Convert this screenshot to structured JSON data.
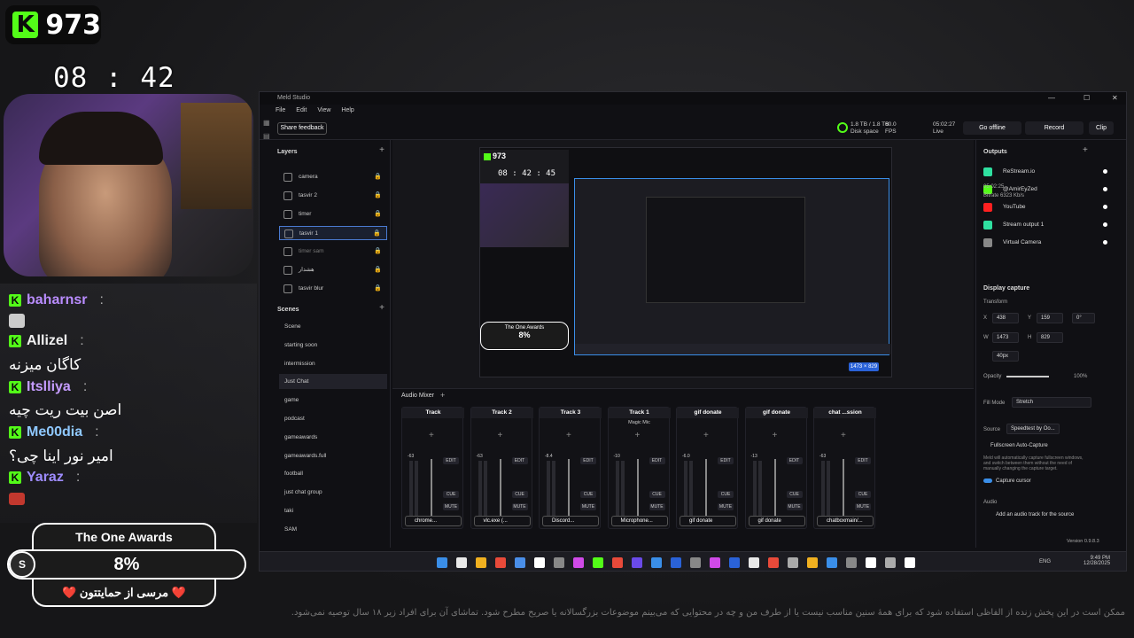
{
  "overlay": {
    "followers": "973",
    "timer": "08 : 42 : 45",
    "chat": [
      {
        "user": "baharnsr",
        "color": "#b98cff",
        "msg": ""
      },
      {
        "user": "Allizel",
        "color": "#f0f0f0",
        "msg": "کاگان میزنه"
      },
      {
        "user": "Itslliya",
        "color": "#c59cff",
        "msg": "اصن بیت ریت چیه"
      },
      {
        "user": "Me00dia",
        "color": "#8fc8ff",
        "msg": "امیر نور اینا چی؟"
      },
      {
        "user": "Yaraz",
        "color": "#9e8cff",
        "msg": ""
      }
    ],
    "awards_title": "The One Awards",
    "awards_percent": "8%",
    "awards_coin": "S",
    "awards_sub": "❤️ مرسی از حمایتتون ❤️"
  },
  "app": {
    "title": "Meld Studio",
    "menu": [
      "File",
      "Edit",
      "View",
      "Help"
    ],
    "share_feedback": "Share feedback",
    "disk": "1.8 TB / 1.8 TB",
    "disk_label": "Disk space",
    "fps": "60.0",
    "fps_label": "FPS",
    "live_time": "05:02:27",
    "live_label": "Live",
    "go_offline": "Go offline",
    "record": "Record",
    "clip": "Clip",
    "layers_title": "Layers",
    "layers": [
      {
        "name": "camera",
        "state": "normal"
      },
      {
        "name": "tasvir 2",
        "state": "normal"
      },
      {
        "name": "timer",
        "state": "normal"
      },
      {
        "name": "tasvir 1",
        "state": "selected"
      },
      {
        "name": "timer sam",
        "state": "dim"
      },
      {
        "name": "هشدار",
        "state": "normal"
      },
      {
        "name": "tasvir blur",
        "state": "normal"
      }
    ],
    "scenes_title": "Scenes",
    "scenes": [
      "Scene",
      "starting soon",
      "intermission",
      "Just Chat",
      "game",
      "podcast",
      "gameawards",
      "gameawards.full",
      "football",
      "just chat group",
      "taki",
      "SAM"
    ],
    "selected_scene": "Just Chat",
    "size_badge": "1473 × 829",
    "mixer_title": "Audio Mixer",
    "tracks": [
      {
        "name": "Track",
        "source": "chrome...",
        "db": "-63"
      },
      {
        "name": "Track 2",
        "source": "vlc.exe (...",
        "db": "-63"
      },
      {
        "name": "Track 3",
        "source": "Discord...",
        "db": "-8.4"
      },
      {
        "name": "Track 1",
        "source": "Microphone...",
        "db": "-10",
        "sub": "Magic Mic"
      },
      {
        "name": "gif donate",
        "source": "gif donate",
        "db": "-6.0"
      },
      {
        "name": "gif donate",
        "source": "gif donate",
        "db": "-13"
      },
      {
        "name": "chat ...ssion",
        "source": "chatboxmain/...",
        "db": "-63"
      }
    ],
    "track_buttons": [
      "EDIT",
      "CUE",
      "MUTE"
    ],
    "outputs_title": "Outputs",
    "outputs": [
      {
        "name": "ReStream.io",
        "color": "#2fe0a0"
      },
      {
        "name": "@AmirEyZed",
        "color": "#53fc18"
      },
      {
        "name": "YouTube",
        "color": "#ff2020"
      },
      {
        "name": "Stream output 1",
        "color": "#2fe0a0"
      },
      {
        "name": "Virtual Camera",
        "color": "#888888"
      }
    ],
    "restream_time": "05:02:25",
    "restream_bitrate": "Bitrate 6323 Kb/s",
    "display_capture": "Display capture",
    "transform": "Transform",
    "x": "438",
    "y": "159",
    "rot": "0°",
    "w": "1473",
    "h": "829",
    "px": "40px",
    "opacity_label": "Opacity",
    "opacity": "100%",
    "fill_mode_label": "Fill Mode",
    "fill_mode": "Stretch",
    "source_label": "Source",
    "source": "Speedtest by Oo...",
    "fullscreen": "Fullscreen Auto-Capture",
    "fullscreen_desc": "Meld will automatically capture fullscreen windows, and switch between them without the need of manually changing the capture target.",
    "capture_cursor": "Capture cursor",
    "audio_label": "Audio",
    "add_audio": "Add an audio track for the source",
    "version": "Version 0.9.8.3",
    "tray_lang": "ENG",
    "clock_time": "9:49 PM",
    "clock_date": "12/28/2025"
  },
  "footer_text": "ممکن است در این پخش زنده از الفاظی استفاده شود که برای همهٔ سنین مناسب نیست یا از طرف من و چه در محتوایی که می‌بینم موضوعات بزرگسالانه یا صریح مطرح شود. تماشای آن برای افراد زیر ۱۸ سال توصیه نمی‌شود."
}
